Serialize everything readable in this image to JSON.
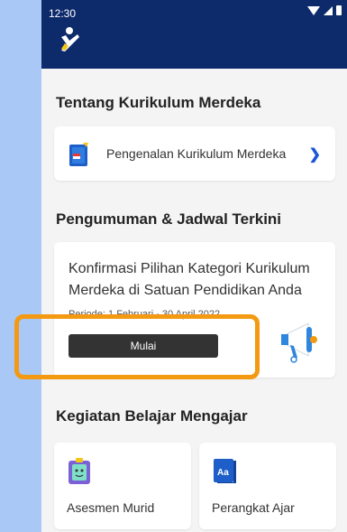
{
  "status": {
    "time": "12:30"
  },
  "sections": {
    "about_title": "Tentang Kurikulum Merdeka",
    "intro_item": "Pengenalan Kurikulum Merdeka",
    "announcements_title": "Pengumuman & Jadwal Terkini",
    "activity_title": "Kegiatan Belajar Mengajar"
  },
  "announcement": {
    "title": "Konfirmasi Pilihan Kategori Kurikulum Merdeka di Satuan Pendidikan Anda",
    "date": "Periode: 1 Februari - 30 April 2022",
    "button": "Mulai"
  },
  "activities": [
    {
      "label": "Asesmen Murid"
    },
    {
      "label": "Perangkat Ajar"
    }
  ],
  "colors": {
    "appbar": "#0d2a6b",
    "accent_blue": "#1a56d6",
    "highlight": "#f39a12",
    "page_bg": "#f4f4f4",
    "left_bg": "#a9c8f5"
  },
  "icons": {
    "logo": "app-logo-icon",
    "book": "book-icon",
    "megaphone": "megaphone-icon",
    "assessment": "assessment-icon",
    "teaching": "teaching-materials-icon"
  }
}
